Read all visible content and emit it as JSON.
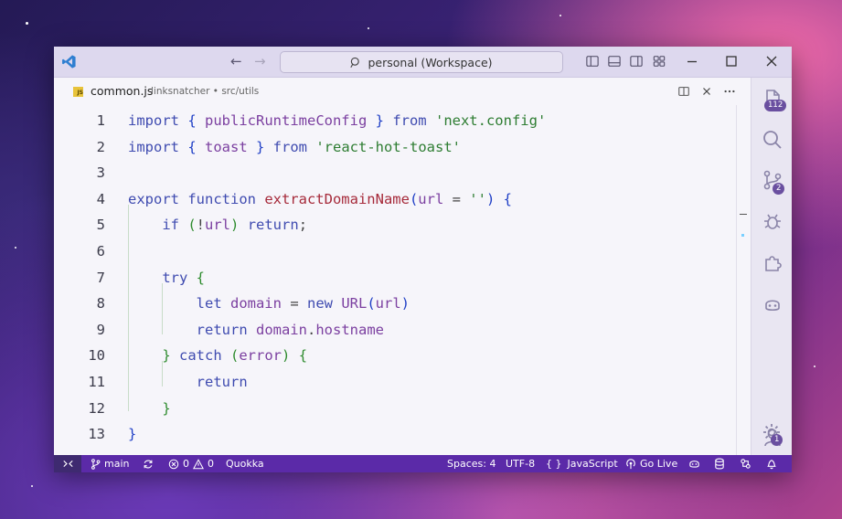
{
  "window": {
    "search": "personal (Workspace)"
  },
  "tab": {
    "filename": "common.js",
    "path": "linksnatcher • src/utils",
    "file_icon_text": "JS"
  },
  "code": [
    {
      "n": "1",
      "src": [
        [
          "kw",
          "import "
        ],
        [
          "br1",
          "{ "
        ],
        [
          "id",
          "publicRuntimeConfig"
        ],
        [
          "br1",
          " }"
        ],
        [
          "kw",
          " from "
        ],
        [
          "str",
          "'next.config'"
        ]
      ]
    },
    {
      "n": "2",
      "src": [
        [
          "kw",
          "import "
        ],
        [
          "br1",
          "{ "
        ],
        [
          "id",
          "toast"
        ],
        [
          "br1",
          " }"
        ],
        [
          "kw",
          " from "
        ],
        [
          "str",
          "'react-hot-toast'"
        ]
      ]
    },
    {
      "n": "3",
      "src": []
    },
    {
      "n": "4",
      "src": [
        [
          "kw",
          "export function "
        ],
        [
          "fn",
          "extractDomainName"
        ],
        [
          "br1",
          "("
        ],
        [
          "id",
          "url"
        ],
        [
          "plain",
          " = "
        ],
        [
          "str",
          "''"
        ],
        [
          "br1",
          ")"
        ],
        [
          "plain",
          " "
        ],
        [
          "br1",
          "{"
        ]
      ]
    },
    {
      "n": "5",
      "src": [
        [
          "plain",
          "    "
        ],
        [
          "kw",
          "if "
        ],
        [
          "br2",
          "("
        ],
        [
          "plain",
          "!"
        ],
        [
          "id",
          "url"
        ],
        [
          "br2",
          ")"
        ],
        [
          "kw",
          " return"
        ],
        [
          "plain",
          ";"
        ]
      ]
    },
    {
      "n": "6",
      "src": []
    },
    {
      "n": "7",
      "src": [
        [
          "plain",
          "    "
        ],
        [
          "kw",
          "try "
        ],
        [
          "br2",
          "{"
        ]
      ]
    },
    {
      "n": "8",
      "src": [
        [
          "plain",
          "        "
        ],
        [
          "kw",
          "let "
        ],
        [
          "id",
          "domain"
        ],
        [
          "plain",
          " = "
        ],
        [
          "kw",
          "new "
        ],
        [
          "id",
          "URL"
        ],
        [
          "br1",
          "("
        ],
        [
          "id",
          "url"
        ],
        [
          "br1",
          ")"
        ]
      ]
    },
    {
      "n": "9",
      "src": [
        [
          "plain",
          "        "
        ],
        [
          "kw",
          "return "
        ],
        [
          "id",
          "domain"
        ],
        [
          "plain",
          "."
        ],
        [
          "id",
          "hostname"
        ]
      ]
    },
    {
      "n": "10",
      "src": [
        [
          "plain",
          "    "
        ],
        [
          "br2",
          "}"
        ],
        [
          "kw",
          " catch "
        ],
        [
          "br2",
          "("
        ],
        [
          "id",
          "error"
        ],
        [
          "br2",
          ")"
        ],
        [
          "plain",
          " "
        ],
        [
          "br2",
          "{"
        ]
      ]
    },
    {
      "n": "11",
      "src": [
        [
          "plain",
          "        "
        ],
        [
          "kw",
          "return"
        ]
      ]
    },
    {
      "n": "12",
      "src": [
        [
          "plain",
          "    "
        ],
        [
          "br2",
          "}"
        ]
      ]
    },
    {
      "n": "13",
      "src": [
        [
          "br1",
          "}"
        ]
      ]
    }
  ],
  "activity_bar": {
    "explorer_badge": "112",
    "source_control_badge": "2",
    "settings_badge": "1"
  },
  "status": {
    "branch": "main",
    "errors": "0",
    "warnings": "0",
    "quokka": "Quokka",
    "spaces": "Spaces: 4",
    "encoding": "UTF-8",
    "language_braces": "{ }",
    "language": "JavaScript",
    "golive": "Go Live"
  },
  "colors": {
    "statusbar": "#5b2aa8",
    "keyword": "#3f4bb0",
    "function": "#a62a3a",
    "string": "#2e7d32",
    "identifier": "#7b3fa0"
  }
}
